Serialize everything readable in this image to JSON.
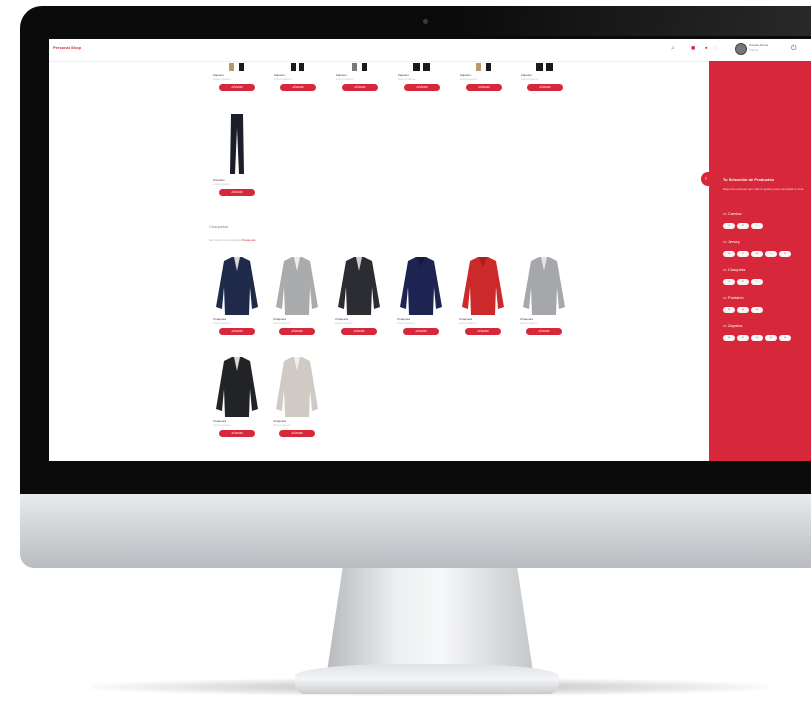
{
  "app": {
    "logo_text": "Personal Shop",
    "accent": "#d6283a"
  },
  "header": {
    "icons": [
      "search-icon",
      "cart-icon",
      "bag-icon",
      "globe-icon"
    ],
    "user": {
      "name": "Usuario Demo",
      "role": "Cliente"
    },
    "logout_icon": "power-icon"
  },
  "catalog": {
    "button_label": "AÑADIR",
    "top_row": [
      {
        "name": "Zapatos",
        "desc": "Lorem ipsum",
        "icon": "shoes-icon"
      },
      {
        "name": "Zapatos",
        "desc": "Lorem ipsum",
        "icon": "shoes-icon"
      },
      {
        "name": "Zapatos",
        "desc": "Lorem ipsum",
        "icon": "shoes-icon"
      },
      {
        "name": "Zapatos",
        "desc": "Lorem ipsum",
        "icon": "shoes-icon"
      },
      {
        "name": "Zapatos",
        "desc": "Lorem ipsum",
        "icon": "shoes-icon"
      },
      {
        "name": "Zapatos",
        "desc": "Lorem ipsum",
        "icon": "shoes-icon"
      }
    ],
    "single": {
      "name": "Pantalón",
      "desc": "Lorem ipsum",
      "icon": "trousers-icon"
    },
    "section": {
      "title": "Chaquetas",
      "link_prefix": "Ver todos los productos",
      "link_accent": "Chaquetas"
    },
    "jackets": [
      {
        "name": "Chaqueta",
        "desc": "Lorem ipsum",
        "color": "#1f2a4a"
      },
      {
        "name": "Chaqueta",
        "desc": "Lorem ipsum",
        "color": "#a9abad"
      },
      {
        "name": "Chaqueta",
        "desc": "Lorem ipsum",
        "color": "#2b2d33"
      },
      {
        "name": "Chaqueta",
        "desc": "Lorem ipsum",
        "color": "#1d2452"
      },
      {
        "name": "Chaqueta",
        "desc": "Lorem ipsum",
        "color": "#cc2a2a"
      },
      {
        "name": "Chaqueta",
        "desc": "Lorem ipsum",
        "color": "#a6a7aa"
      }
    ],
    "jackets_row2": [
      {
        "name": "Chaqueta",
        "desc": "Lorem ipsum",
        "color": "#222326"
      },
      {
        "name": "Chaqueta",
        "desc": "Lorem ipsum",
        "color": "#cfcac3"
      }
    ]
  },
  "sidebar": {
    "collapse_icon": "chevron-left-icon",
    "title": "Tu Selección de Productos",
    "subtitle": "Elige las opciones que más te gusten para completar tu look",
    "groups": [
      {
        "label": "Camisa",
        "icon": "shirt-icon",
        "chips": [
          "S",
          "M",
          "L"
        ]
      },
      {
        "label": "Jersey",
        "icon": "sweater-icon",
        "chips": [
          "XS",
          "S",
          "M",
          "L",
          "XL"
        ]
      },
      {
        "label": "Chaqueta",
        "icon": "jacket-icon",
        "chips": [
          "S",
          "M",
          "L"
        ]
      },
      {
        "label": "Pantalón",
        "icon": "trousers-icon",
        "chips": [
          "38",
          "40",
          "42"
        ]
      },
      {
        "label": "Zapatos",
        "icon": "shoes-icon",
        "chips": [
          "40",
          "41",
          "42",
          "43",
          "44"
        ]
      }
    ]
  }
}
